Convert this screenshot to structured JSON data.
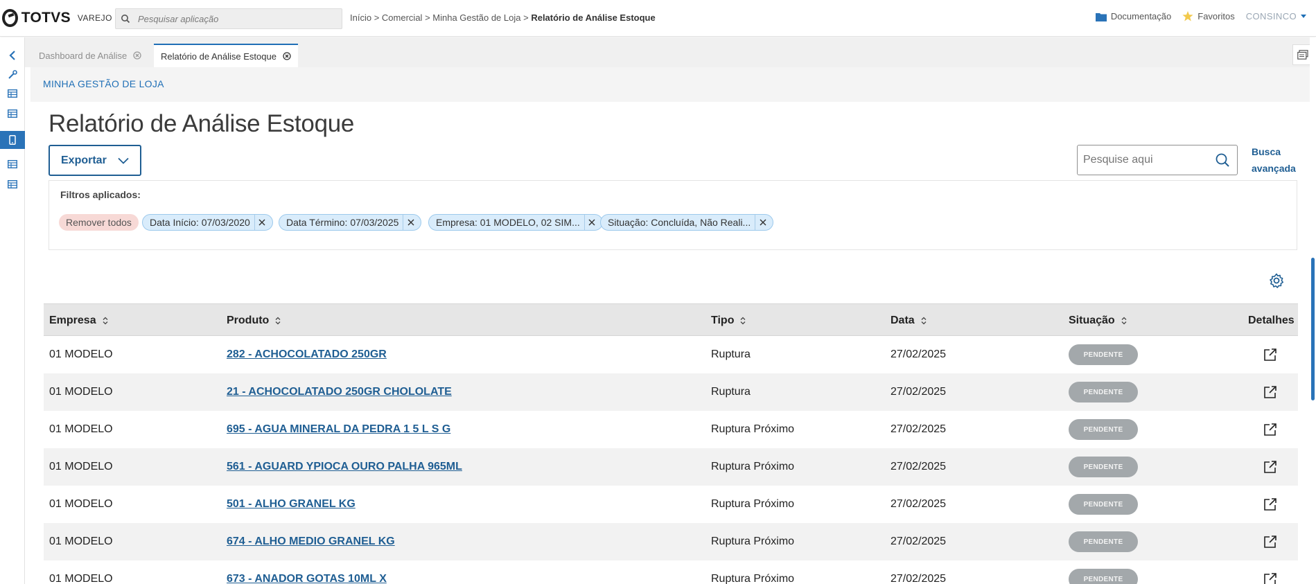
{
  "topbar": {
    "brand_name": "TOTVS",
    "brand_sub": "VAREJO",
    "search_placeholder": "Pesquisar aplicação",
    "breadcrumb": {
      "items": [
        "Início",
        "Comercial",
        "Minha Gestão de Loja"
      ],
      "separator": ">",
      "current": "Relatório de Análise Estoque"
    },
    "documentation": "Documentação",
    "favorites": "Favoritos",
    "user": "CONSINCO"
  },
  "leftrail": {
    "icons": [
      "chevron-left-icon",
      "wrench-icon",
      "table-icon",
      "table-icon",
      "mobile-icon",
      "table-icon",
      "table-icon"
    ],
    "active_index": 4
  },
  "tabs": [
    {
      "label": "Dashboard de Análise",
      "active": false
    },
    {
      "label": "Relatório de Análise Estoque",
      "active": true
    }
  ],
  "section": {
    "title": "MINHA GESTÃO DE LOJA"
  },
  "page": {
    "title": "Relatório de Análise Estoque",
    "export_label": "Exportar",
    "search_placeholder": "Pesquise aqui",
    "advanced_search": "Busca avançada"
  },
  "filters": {
    "label": "Filtros aplicados:",
    "remove_all": "Remover todos",
    "chips": [
      "Data Início: 07/03/2020",
      "Data Término: 07/03/2025",
      "Empresa: 01 MODELO, 02 SIM...",
      "Situação: Concluída, Não Reali..."
    ]
  },
  "table": {
    "columns": {
      "empresa": "Empresa",
      "produto": "Produto",
      "tipo": "Tipo",
      "data": "Data",
      "situacao": "Situação",
      "detalhes": "Detalhes"
    },
    "rows": [
      {
        "empresa": "01 MODELO",
        "produto": "282 - ACHOCOLATADO 250GR",
        "tipo": "Ruptura",
        "data": "27/02/2025",
        "situacao": "PENDENTE"
      },
      {
        "empresa": "01 MODELO",
        "produto": "21 - ACHOCOLATADO 250GR CHOLOLATE",
        "tipo": "Ruptura",
        "data": "27/02/2025",
        "situacao": "PENDENTE"
      },
      {
        "empresa": "01 MODELO",
        "produto": "695 - AGUA MINERAL DA PEDRA 1 5 L S G",
        "tipo": "Ruptura Próximo",
        "data": "27/02/2025",
        "situacao": "PENDENTE"
      },
      {
        "empresa": "01 MODELO",
        "produto": "561 - AGUARD YPIOCA OURO PALHA 965ML",
        "tipo": "Ruptura Próximo",
        "data": "27/02/2025",
        "situacao": "PENDENTE"
      },
      {
        "empresa": "01 MODELO",
        "produto": "501 - ALHO GRANEL KG",
        "tipo": "Ruptura Próximo",
        "data": "27/02/2025",
        "situacao": "PENDENTE"
      },
      {
        "empresa": "01 MODELO",
        "produto": "674 - ALHO MEDIO GRANEL KG",
        "tipo": "Ruptura Próximo",
        "data": "27/02/2025",
        "situacao": "PENDENTE"
      },
      {
        "empresa": "01 MODELO",
        "produto": "673 - ANADOR GOTAS 10ML X",
        "tipo": "Ruptura Próximo",
        "data": "27/02/2025",
        "situacao": "PENDENTE"
      }
    ]
  },
  "colors": {
    "accent": "#1f5e93",
    "primary": "#2a73b8",
    "badge_pending": "#a3a8ab",
    "chip_filter": "#d9ecfb",
    "chip_remove": "#f7d9d6",
    "favorite_star": "#f2c94c",
    "folder": "#2a73b8"
  }
}
